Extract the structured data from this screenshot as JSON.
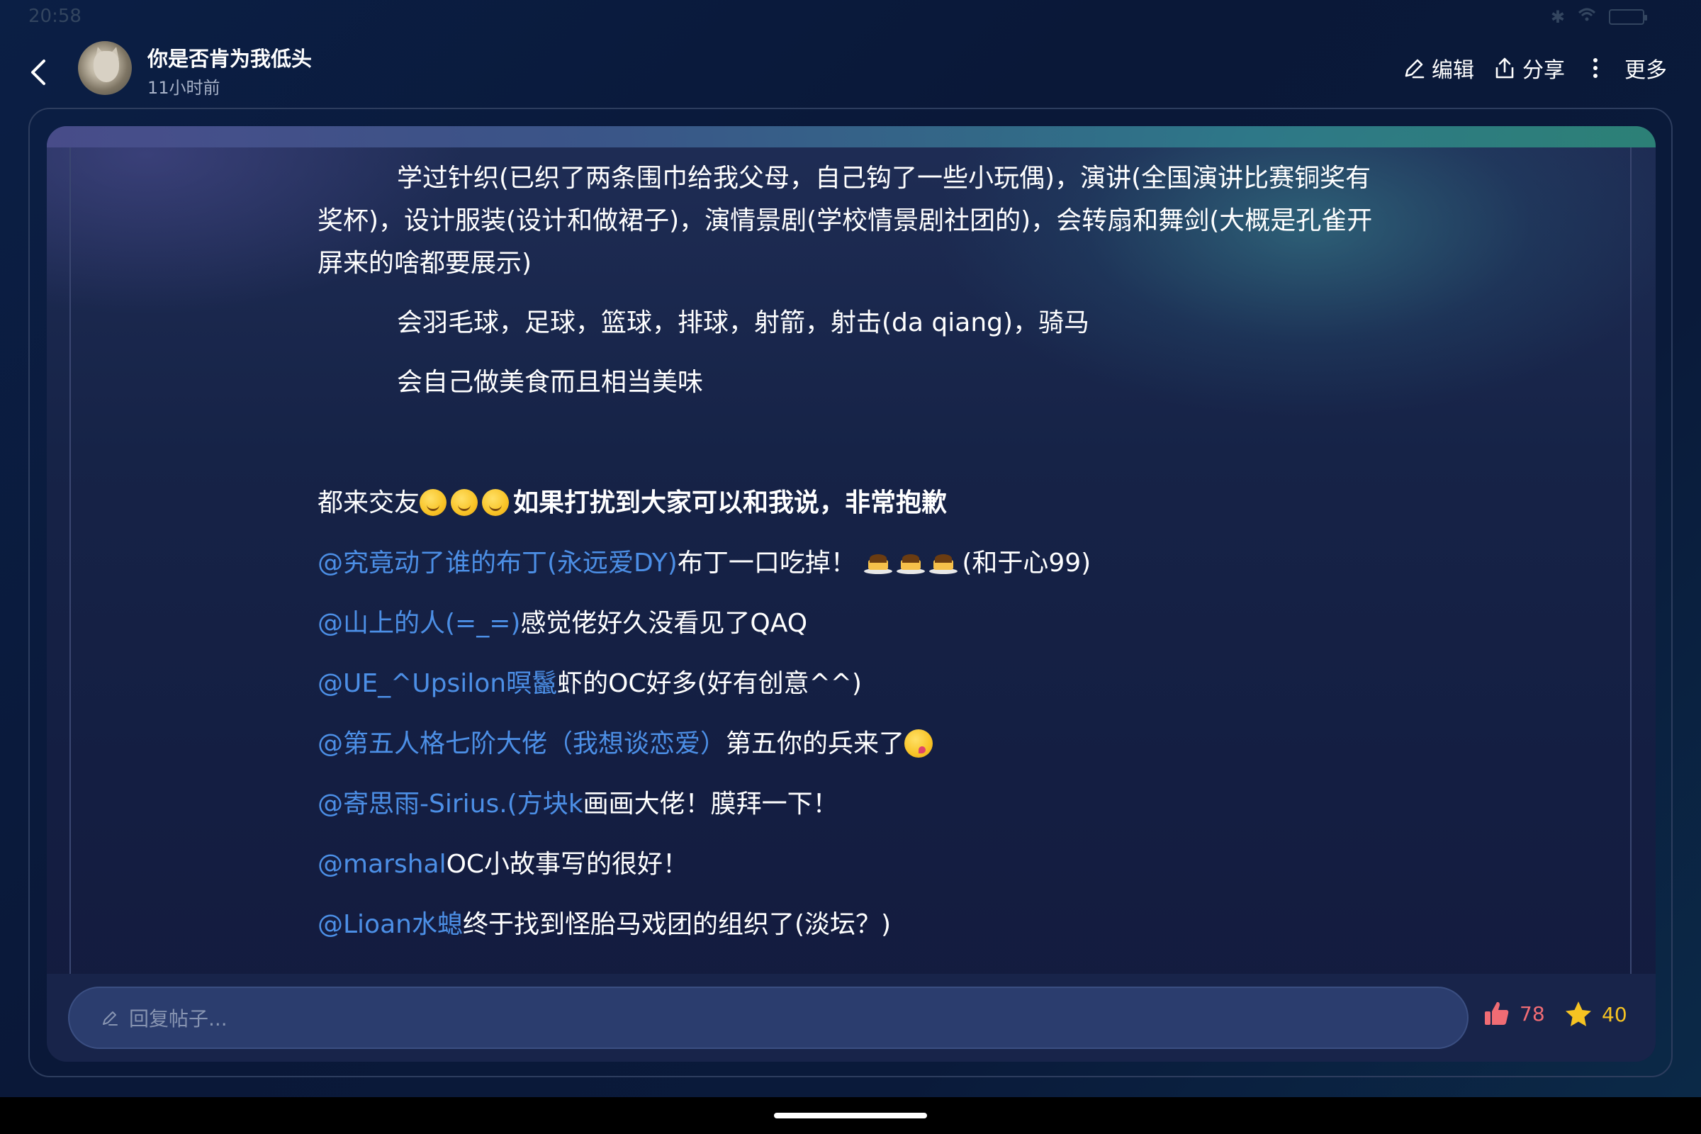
{
  "status_bar": {
    "time": "20:58",
    "battery": "17"
  },
  "header": {
    "author": "你是否肯为我低头",
    "post_time": "11小时前",
    "actions": {
      "edit": "编辑",
      "share": "分享",
      "more": "更多"
    }
  },
  "post": {
    "paragraphs": [
      "学过针织(已织了两条围巾给我父母，自己钩了一些小玩偶)，演讲(全国演讲比赛铜奖有奖杯)，设计服装(设计和做裙子)，演情景剧(学校情景剧社团的)，会转扇和舞剑(大概是孔雀开屏来的啥都要展示)",
      "会羽毛球，足球，篮球，排球，射箭，射击(da qiang)，骑马",
      "会自己做美食而且相当美味"
    ],
    "friend_line": {
      "prefix": "都来交友",
      "bold_text": "如果打扰到大家可以和我说，非常抱歉"
    },
    "mentions": [
      {
        "mention": "@究竟动了谁的布丁(永远爱DY)",
        "text_before_emoji": "布丁一口吃掉！",
        "text_after_emoji": "(和于心99)"
      },
      {
        "mention": "@山上的人(=_=)",
        "text": "感觉佬好久没看见了QAQ"
      },
      {
        "mention": "@UE_^Upsilon暝鬣",
        "text": "虾的OC好多(好有创意^^)"
      },
      {
        "mention": "@第五人格七阶大佬（我想谈恋爱）",
        "text": "第五你的兵来了"
      },
      {
        "mention": "@寄思雨-Sirius.(方块k",
        "text": "画画大佬！膜拜一下！"
      },
      {
        "mention": "@marshal",
        "text": "OC小故事写的很好！"
      },
      {
        "mention": "@Lioan水螅",
        "text": "终于找到怪胎马戏团的组织了(淡坛？)"
      }
    ]
  },
  "bottom_bar": {
    "reply_placeholder": "回复帖子...",
    "likes": "78",
    "favorites": "40"
  },
  "icons": {
    "back": "back-arrow-icon",
    "edit": "pencil-icon",
    "share": "share-icon",
    "more": "more-vertical-icon",
    "reply": "pencil-icon",
    "like": "thumbs-up-icon",
    "favorite": "star-icon"
  },
  "colors": {
    "mention": "#4c8fe6",
    "like": "#f06c74",
    "favorite": "#f6c322",
    "background": "#0a1838"
  }
}
